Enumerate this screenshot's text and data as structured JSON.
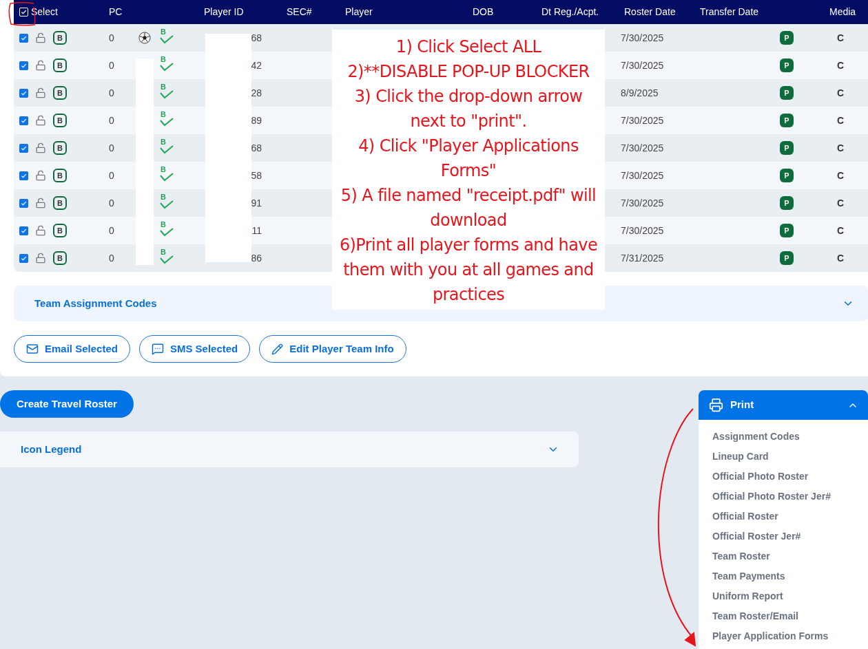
{
  "table": {
    "select_all": {
      "label": "Select",
      "checked": true
    },
    "columns": [
      "PC",
      "Player ID",
      "SEC#",
      "Player",
      "DOB",
      "Dt Reg./Acpt.",
      "Roster Date",
      "Transfer Date",
      "Media"
    ],
    "rows": [
      {
        "selected": true,
        "locked": false,
        "badge": "B",
        "pc": "0",
        "ball": true,
        "verified_mark": "B",
        "player_id": "68",
        "roster_date": "7/30/2025",
        "status": "P",
        "media": "C"
      },
      {
        "selected": true,
        "locked": false,
        "badge": "B",
        "pc": "0",
        "ball": false,
        "verified_mark": "B",
        "player_id": "42",
        "roster_date": "7/30/2025",
        "status": "P",
        "media": "C"
      },
      {
        "selected": true,
        "locked": false,
        "badge": "B",
        "pc": "0",
        "ball": false,
        "verified_mark": "B",
        "player_id": "28",
        "roster_date": "8/9/2025",
        "status": "P",
        "media": "C"
      },
      {
        "selected": true,
        "locked": false,
        "badge": "B",
        "pc": "0",
        "ball": false,
        "verified_mark": "B",
        "player_id": "89",
        "roster_date": "7/30/2025",
        "status": "P",
        "media": "C"
      },
      {
        "selected": true,
        "locked": false,
        "badge": "B",
        "pc": "0",
        "ball": false,
        "verified_mark": "B",
        "player_id": "68",
        "roster_date": "7/30/2025",
        "status": "P",
        "media": "C"
      },
      {
        "selected": true,
        "locked": false,
        "badge": "B",
        "pc": "0",
        "ball": false,
        "verified_mark": "B",
        "player_id": "58",
        "roster_date": "7/30/2025",
        "status": "P",
        "media": "C"
      },
      {
        "selected": true,
        "locked": false,
        "badge": "B",
        "pc": "0",
        "ball": false,
        "verified_mark": "B",
        "player_id": "91",
        "roster_date": "7/30/2025",
        "status": "P",
        "media": "C"
      },
      {
        "selected": true,
        "locked": false,
        "badge": "B",
        "pc": "0",
        "ball": false,
        "verified_mark": "B",
        "player_id": "11",
        "roster_date": "7/30/2025",
        "status": "P",
        "media": "C"
      },
      {
        "selected": true,
        "locked": false,
        "badge": "B",
        "pc": "0",
        "ball": false,
        "verified_mark": "B",
        "player_id": "86",
        "roster_date": "7/31/2025",
        "status": "P",
        "media": "C"
      }
    ]
  },
  "team_assignment_panel": {
    "title": "Team Assignment Codes",
    "expanded": false
  },
  "actions": [
    {
      "label": "Email Selected",
      "kind": "email"
    },
    {
      "label": "SMS Selected",
      "kind": "sms"
    },
    {
      "label": "Edit Player Team Info",
      "kind": "edit"
    }
  ],
  "create_travel_roster": "Create Travel Roster",
  "icon_legend_panel": {
    "title": "Icon Legend",
    "expanded": false
  },
  "print_menu": {
    "label": "Print",
    "expanded": true,
    "items": [
      "Assignment Codes",
      "Lineup Card",
      "Official Photo Roster",
      "Official Photo Roster Jer#",
      "Official Roster",
      "Official Roster Jer#",
      "Team Roster",
      "Team Payments",
      "Uniform Report",
      "Team Roster/Email",
      "Player Application Forms"
    ]
  },
  "annotation": {
    "steps": [
      "1) Click Select ALL",
      "2)**DISABLE POP-UP BLOCKER",
      "3) Click the drop-down arrow next to \"print\".",
      "4) Click \"Player Applications Forms\"",
      "5) A file named \"receipt.pdf\" will download",
      "6)Print all player forms and have them with you at all games and practices"
    ]
  }
}
